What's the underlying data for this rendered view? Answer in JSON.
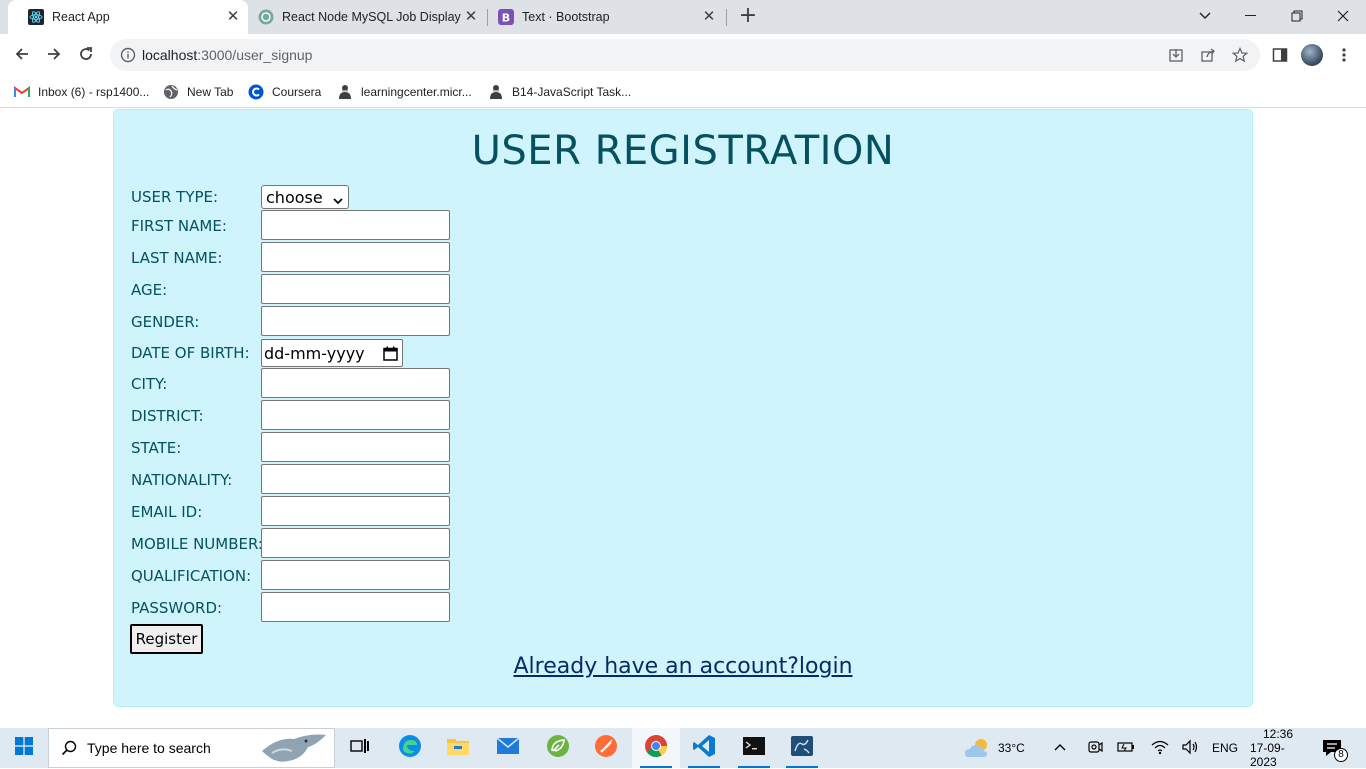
{
  "browser": {
    "tabs": [
      {
        "title": "React App",
        "icon": "react-icon"
      },
      {
        "title": "React Node MySQL Job Display",
        "icon": "chatgpt-icon"
      },
      {
        "title": "Text · Bootstrap",
        "icon": "bootstrap-icon"
      }
    ],
    "url_host": "localhost",
    "url_path": ":3000/user_signup",
    "bookmarks": [
      {
        "label": "Inbox (6) - rsp1400...",
        "icon": "gmail-icon"
      },
      {
        "label": "New Tab",
        "icon": "globe-icon"
      },
      {
        "label": "Coursera",
        "icon": "coursera-icon"
      },
      {
        "label": "learningcenter.micr...",
        "icon": "person-icon"
      },
      {
        "label": "B14-JavaScript Task...",
        "icon": "person-icon"
      }
    ]
  },
  "form": {
    "heading": "USER REGISTRATION",
    "user_type_label": "USER TYPE:",
    "user_type_value": "choose",
    "fields": [
      {
        "label": "FIRST NAME:",
        "value": ""
      },
      {
        "label": "LAST NAME:",
        "value": ""
      },
      {
        "label": "AGE:",
        "value": ""
      },
      {
        "label": "GENDER:",
        "value": ""
      }
    ],
    "dob_label": "DATE OF BIRTH:",
    "dob_placeholder": "dd-mm-yyyy",
    "fields2": [
      {
        "label": "CITY:",
        "value": ""
      },
      {
        "label": "DISTRICT:",
        "value": ""
      },
      {
        "label": "STATE:",
        "value": ""
      },
      {
        "label": "NATIONALITY:",
        "value": ""
      },
      {
        "label": "EMAIL ID:",
        "value": ""
      },
      {
        "label": "MOBILE NUMBER:",
        "value": ""
      },
      {
        "label": "QUALIFICATION:",
        "value": ""
      },
      {
        "label": "PASSWORD:",
        "value": ""
      }
    ],
    "register_label": "Register",
    "login_link": "Already have an account?login"
  },
  "taskbar": {
    "search_placeholder": "Type here to search",
    "weather": "33°C",
    "language": "ENG",
    "time": "12:36",
    "date": "17-09-2023",
    "notification_count": "8"
  },
  "colors": {
    "card_bg": "#cff4fc",
    "card_text": "#055160",
    "link": "#052c65"
  }
}
